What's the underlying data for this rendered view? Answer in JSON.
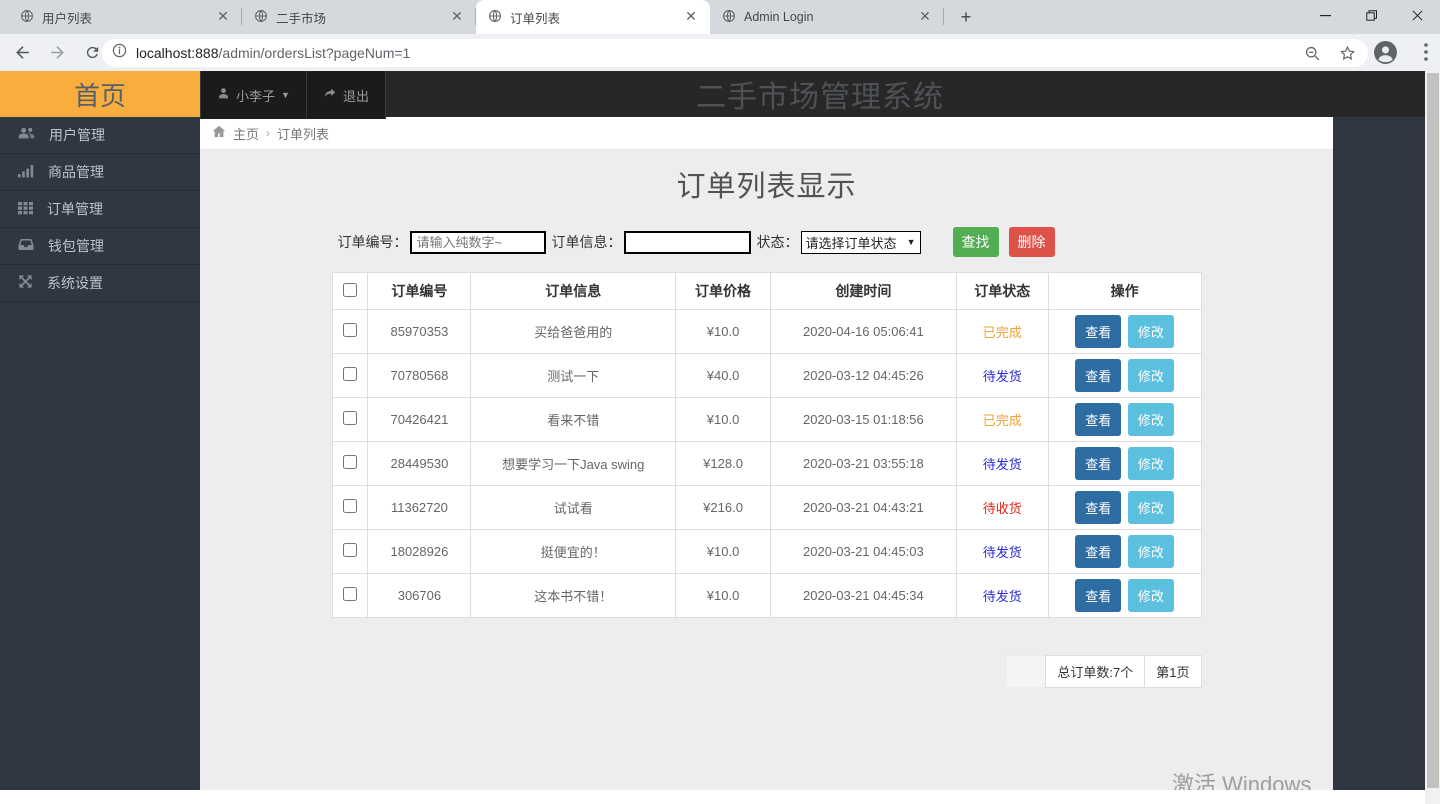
{
  "browser": {
    "tabs": [
      {
        "title": "用户列表"
      },
      {
        "title": "二手市场"
      },
      {
        "title": "订单列表",
        "active": true
      },
      {
        "title": "Admin Login"
      }
    ],
    "url_host": "localhost:888",
    "url_path": "/admin/ordersList?pageNum=1"
  },
  "header": {
    "home_label": "首页",
    "username": "小李子",
    "logout_label": "退出",
    "system_title": "二手市场管理系统"
  },
  "sidebar": {
    "items": [
      {
        "icon": "users-icon",
        "label": "用户管理"
      },
      {
        "icon": "signal-bars-icon",
        "label": "商品管理"
      },
      {
        "icon": "grid-icon",
        "label": "订单管理"
      },
      {
        "icon": "inbox-icon",
        "label": "钱包管理"
      },
      {
        "icon": "arrows-icon",
        "label": "系统设置"
      }
    ]
  },
  "breadcrumb": {
    "home": "主页",
    "current": "订单列表"
  },
  "page": {
    "title": "订单列表显示"
  },
  "filters": {
    "order_no_label": "订单编号：",
    "order_no_placeholder": "请输入纯数字~",
    "order_info_label": "订单信息：",
    "order_info_value": "",
    "status_label": "状态：",
    "status_selected": "请选择订单状态",
    "search_label": "查找",
    "delete_label": "删除"
  },
  "table": {
    "headers": [
      "订单编号",
      "订单信息",
      "订单价格",
      "创建时间",
      "订单状态",
      "操作"
    ],
    "view_label": "查看",
    "edit_label": "修改",
    "status_colors": {
      "已完成": "#f0a23c",
      "待发货": "#2b2bd5",
      "待收货": "#e2261b"
    },
    "rows": [
      {
        "id": "85970353",
        "info": "买给爸爸用的",
        "price": "¥10.0",
        "created": "2020-04-16 05:06:41",
        "status": "已完成"
      },
      {
        "id": "70780568",
        "info": "测试一下",
        "price": "¥40.0",
        "created": "2020-03-12 04:45:26",
        "status": "待发货"
      },
      {
        "id": "70426421",
        "info": "看来不错",
        "price": "¥10.0",
        "created": "2020-03-15 01:18:56",
        "status": "已完成"
      },
      {
        "id": "28449530",
        "info": "想要学习一下Java swing",
        "price": "¥128.0",
        "created": "2020-03-21 03:55:18",
        "status": "待发货"
      },
      {
        "id": "11362720",
        "info": "试试看",
        "price": "¥216.0",
        "created": "2020-03-21 04:43:21",
        "status": "待收货"
      },
      {
        "id": "18028926",
        "info": "挺便宜的！",
        "price": "¥10.0",
        "created": "2020-03-21 04:45:03",
        "status": "待发货"
      },
      {
        "id": "306706",
        "info": "这本书不错！",
        "price": "¥10.0",
        "created": "2020-03-21 04:45:34",
        "status": "待发货"
      }
    ]
  },
  "pagination": {
    "total_label": "总订单数:7个",
    "page_label": "第1页"
  },
  "watermark": "激活 Windows",
  "colors": {
    "brand_orange": "#f9ad3d",
    "sidebar_bg": "#2f3742",
    "search_green": "#52ae52",
    "delete_red": "#dd5149",
    "view_blue": "#2e6da4",
    "edit_cyan": "#5bc0de"
  }
}
